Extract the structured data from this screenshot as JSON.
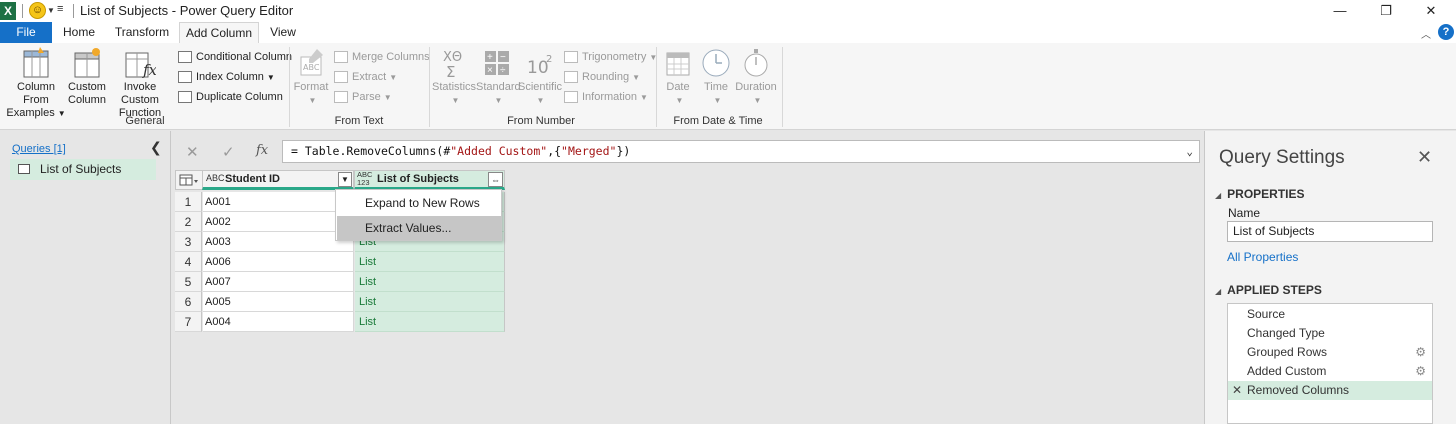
{
  "window": {
    "title": "List of Subjects - Power Query Editor",
    "app_icon_letter": "X",
    "minimize": "—",
    "restore": "❐",
    "close": "✕"
  },
  "ribbon_tabs": {
    "file": "File",
    "items": [
      "Home",
      "Transform",
      "Add Column",
      "View"
    ],
    "active": "Add Column",
    "help": "?"
  },
  "ribbon": {
    "general": {
      "label": "General",
      "column_from_examples_1": "Column From",
      "column_from_examples_2": "Examples",
      "custom_column_1": "Custom",
      "custom_column_2": "Column",
      "invoke_custom_function_1": "Invoke Custom",
      "invoke_custom_function_2": "Function",
      "conditional_column": "Conditional Column",
      "index_column": "Index Column",
      "duplicate_column": "Duplicate Column"
    },
    "from_text": {
      "label": "From Text",
      "format": "Format",
      "merge_columns": "Merge Columns",
      "extract": "Extract",
      "parse": "Parse"
    },
    "from_number": {
      "label": "From Number",
      "statistics": "Statistics",
      "standard": "Standard",
      "scientific": "Scientific",
      "trigonometry": "Trigonometry",
      "rounding": "Rounding",
      "information": "Information"
    },
    "from_date_time": {
      "label": "From Date & Time",
      "date": "Date",
      "time": "Time",
      "duration": "Duration"
    }
  },
  "queries": {
    "title": "Queries [1]",
    "items": [
      "List of Subjects"
    ]
  },
  "formula": {
    "prefix": "= Table.RemoveColumns(#",
    "str1": "\"Added Custom\"",
    "mid": ",{",
    "str2": "\"Merged\"",
    "suffix": "})"
  },
  "grid": {
    "columns": [
      {
        "type_icon": "ABC",
        "name": "Student ID"
      },
      {
        "type_icon": "ABC 123",
        "name": "List of Subjects"
      }
    ],
    "rows": [
      {
        "n": "1",
        "id": "A001",
        "value": "List"
      },
      {
        "n": "2",
        "id": "A002",
        "value": "List"
      },
      {
        "n": "3",
        "id": "A003",
        "value": "List"
      },
      {
        "n": "4",
        "id": "A006",
        "value": "List"
      },
      {
        "n": "5",
        "id": "A007",
        "value": "List"
      },
      {
        "n": "6",
        "id": "A005",
        "value": "List"
      },
      {
        "n": "7",
        "id": "A004",
        "value": "List"
      }
    ]
  },
  "context_menu": {
    "items": [
      "Expand to New Rows",
      "Extract Values..."
    ],
    "hovered": "Extract Values..."
  },
  "settings": {
    "title": "Query Settings",
    "properties_header": "PROPERTIES",
    "name_label": "Name",
    "name_value": "List of Subjects",
    "all_properties": "All Properties",
    "applied_steps_header": "APPLIED STEPS",
    "steps": [
      {
        "name": "Source",
        "gear": false
      },
      {
        "name": "Changed Type",
        "gear": false
      },
      {
        "name": "Grouped Rows",
        "gear": true
      },
      {
        "name": "Added Custom",
        "gear": true
      },
      {
        "name": "Removed Columns",
        "gear": false,
        "selected": true
      }
    ]
  },
  "colors": {
    "accent_blue": "#1570c8",
    "selected_green": "#d5ecdf",
    "list_text_green": "#1a7a3a",
    "excel_green": "#1e7145"
  }
}
